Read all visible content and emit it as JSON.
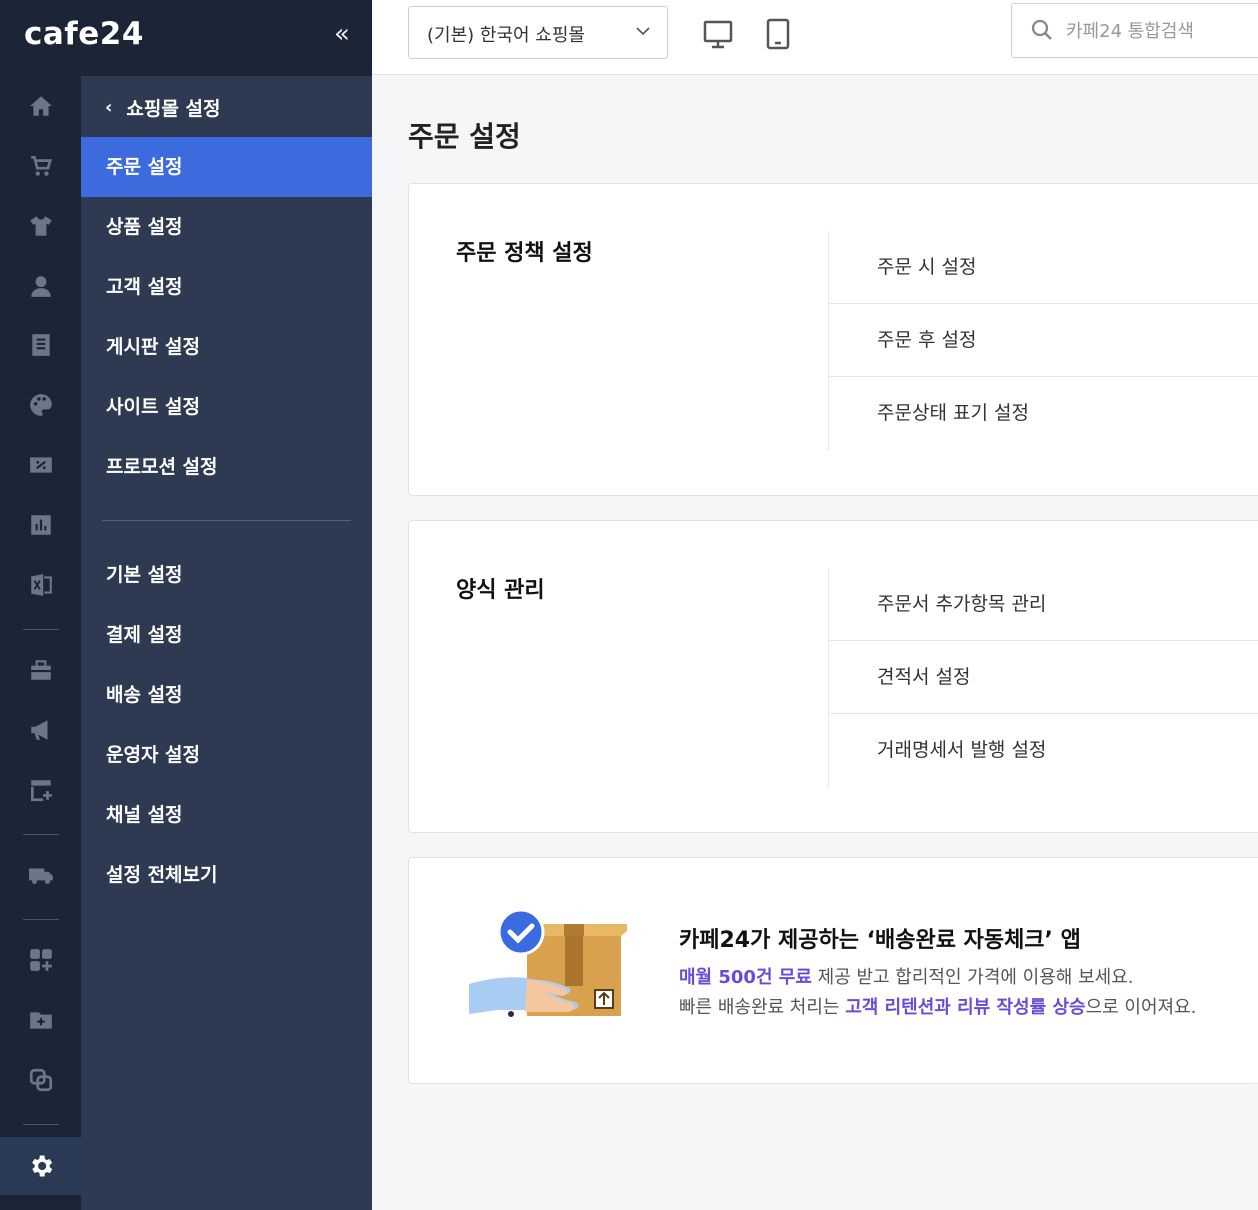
{
  "brand": {
    "logo": "cafe24"
  },
  "topbar": {
    "mall_select": "(기본) 한국어 쇼핑몰",
    "search_placeholder": "카페24 통합검색"
  },
  "submenu": {
    "back_label": "쇼핑몰 설정",
    "items_primary": [
      "주문 설정",
      "상품 설정",
      "고객 설정",
      "게시판 설정",
      "사이트 설정",
      "프로모션 설정"
    ],
    "items_secondary": [
      "기본 설정",
      "결제 설정",
      "배송 설정",
      "운영자 설정",
      "채널 설정",
      "설정 전체보기"
    ],
    "active": "주문 설정"
  },
  "main": {
    "title": "주문 설정",
    "sections": [
      {
        "title": "주문 정책 설정",
        "links": [
          "주문 시 설정",
          "주문 후 설정",
          "주문상태 표기 설정"
        ]
      },
      {
        "title": "양식 관리",
        "links": [
          "주문서 추가항목 관리",
          "견적서 설정",
          "거래명세서 발행 설정"
        ]
      }
    ],
    "promo": {
      "title": "카페24가 제공하는 ‘배송완료 자동체크’ 앱",
      "line1_highlight": "매월 500건 무료",
      "line1_rest": " 제공 받고 합리적인 가격에 이용해 보세요.",
      "line2_pre": "빠른 배송완료 처리는 ",
      "line2_highlight": "고객 리텐션과 리뷰 작성률 상승",
      "line2_post": "으로 이어져요."
    }
  },
  "colors": {
    "rail_bg": "#1b2536",
    "submenu_bg": "#2d3a52",
    "active": "#3d6bde",
    "highlight": "#6a4bd8"
  }
}
